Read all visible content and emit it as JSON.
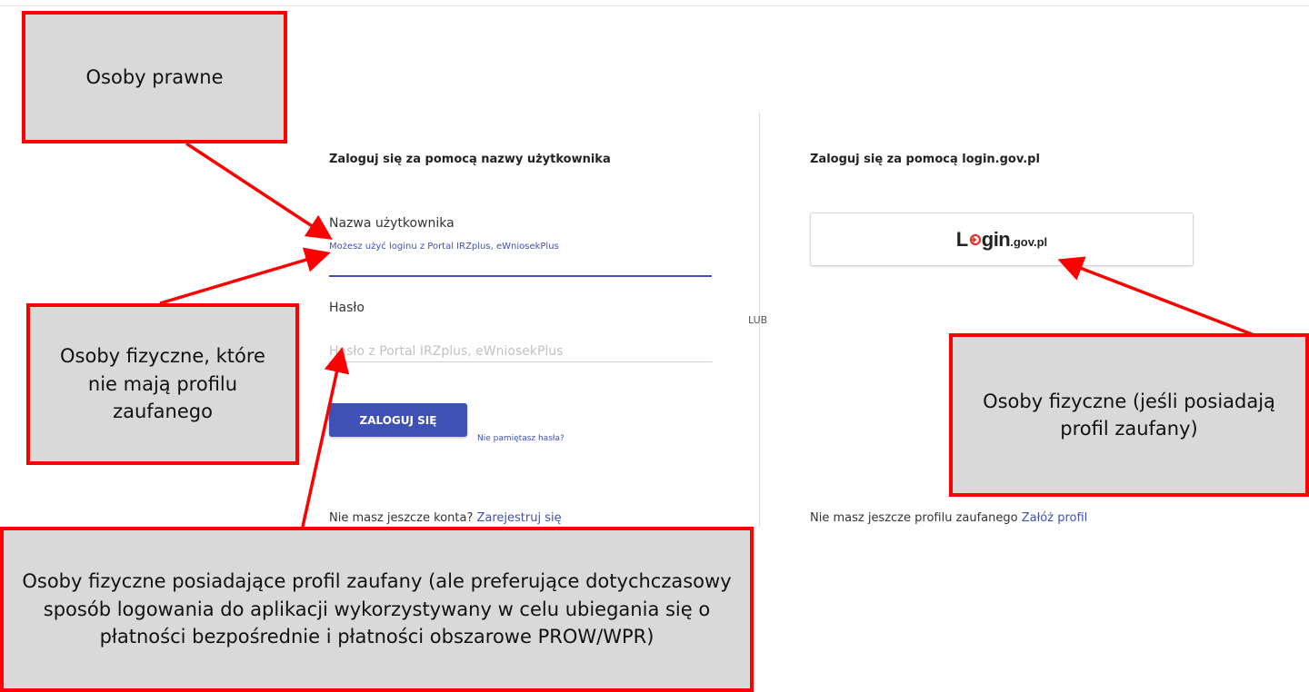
{
  "login_form": {
    "heading": "Zaloguj się za pomocą nazwy użytkownika",
    "username_label": "Nazwa użytkownika",
    "username_hint": "Możesz użyć loginu z Portal IRZplus, eWniosekPlus",
    "username_value": "",
    "password_label": "Hasło",
    "password_placeholder": "Hasło z Portal IRZplus, eWniosekPlus",
    "login_button": "ZALOGUJ SIĘ",
    "forgot_password": "Nie pamiętasz  hasła?",
    "no_account_text": "Nie masz jeszcze konta?",
    "register_link": "Zarejestruj się"
  },
  "separator": {
    "text": "LUB"
  },
  "gov_login": {
    "heading": "Zaloguj się za pomocą login.gov.pl",
    "logo": {
      "L": "L",
      "gin": "gin",
      "suffix": ".gov.pl"
    },
    "no_profile_text": "Nie masz jeszcze profilu zaufanego",
    "create_profile_link": "Załóż profil"
  },
  "annotations": {
    "legal_entities": "Osoby prawne",
    "natural_no_profile": "Osoby fizyczne, które nie mają profilu zaufanego",
    "natural_with_profile": "Osoby fizyczne (jeśli posiadają profil zaufany)",
    "natural_with_profile_preferring": "Osoby fizyczne posiadające profil zaufany (ale preferujące dotychczasowy sposób logowania do aplikacji wykorzystywany w celu ubiegania się o płatności bezpośrednie i płatności obszarowe PROW/WPR)"
  },
  "colors": {
    "accent": "#3f51b5",
    "callout_border": "#ff0000",
    "callout_fill": "#d9d9d9",
    "logo_o": "#e0352b"
  }
}
